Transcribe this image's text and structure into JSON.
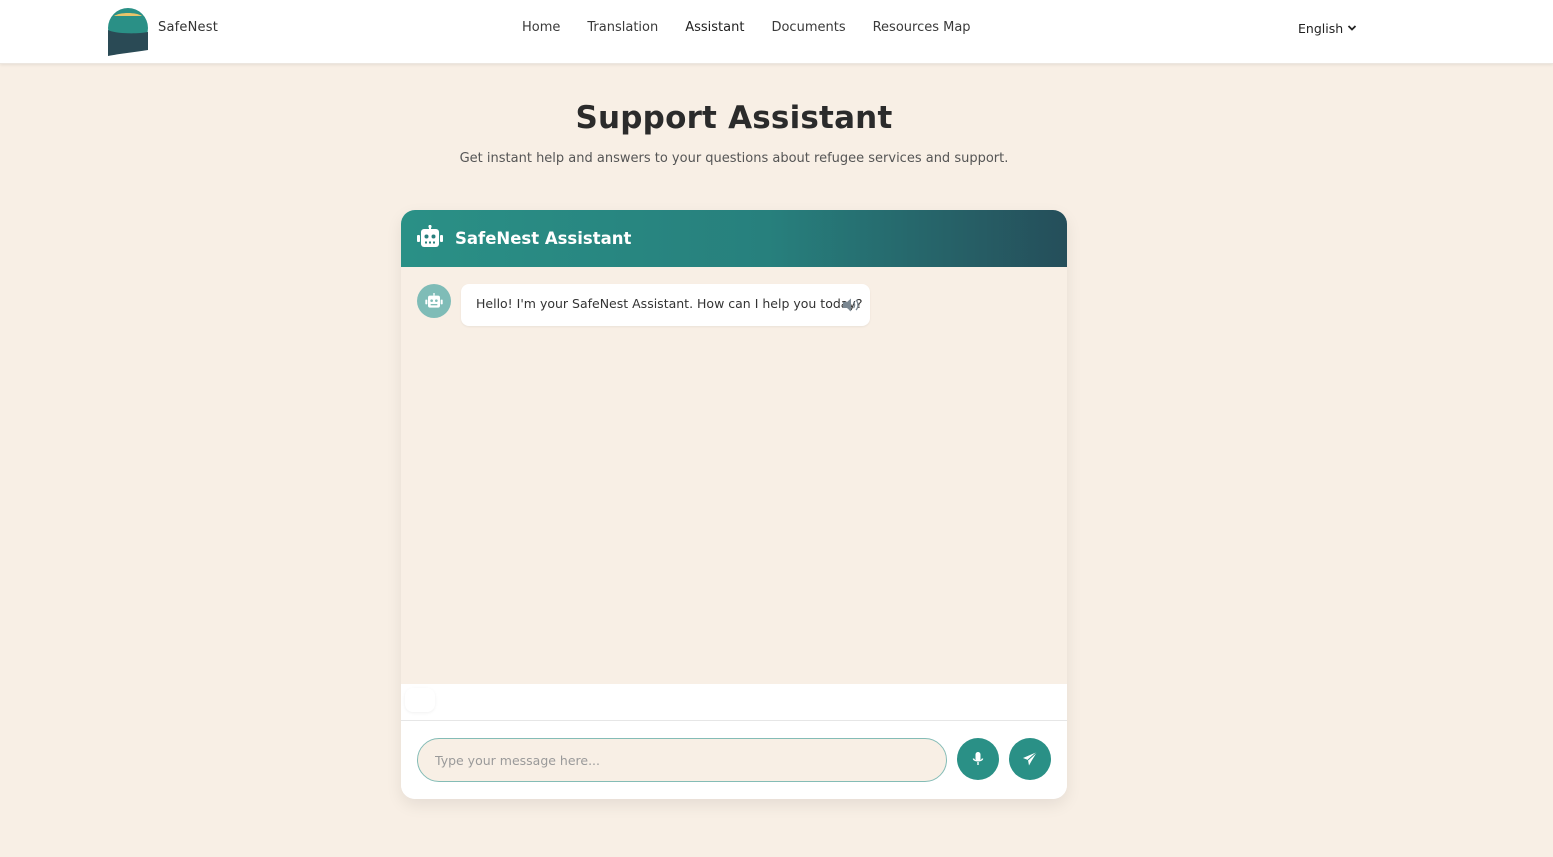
{
  "header": {
    "brand": "SafeNest",
    "nav": [
      {
        "label": "Home"
      },
      {
        "label": "Translation"
      },
      {
        "label": "Assistant"
      },
      {
        "label": "Documents"
      },
      {
        "label": "Resources Map"
      }
    ],
    "language": "English"
  },
  "page": {
    "title": "Support Assistant",
    "subtitle": "Get instant help and answers to your questions about refugee services and support."
  },
  "chat": {
    "header_title": "SafeNest Assistant",
    "messages": [
      {
        "sender": "bot",
        "text": "Hello! I'm your SafeNest Assistant. How can I help you today?"
      }
    ],
    "input_placeholder": "Type your message here..."
  },
  "colors": {
    "accent": "#2a9086",
    "header_gradient_end": "#254e5a",
    "background": "#f8efe5",
    "logo_yellow": "#e8c46a"
  },
  "icons": {
    "logo": "safenest-logo",
    "bot": "robot-icon",
    "speaker": "speaker-icon",
    "mic": "microphone-icon",
    "send": "paper-plane-icon",
    "dropdown": "chevron-down-icon"
  }
}
